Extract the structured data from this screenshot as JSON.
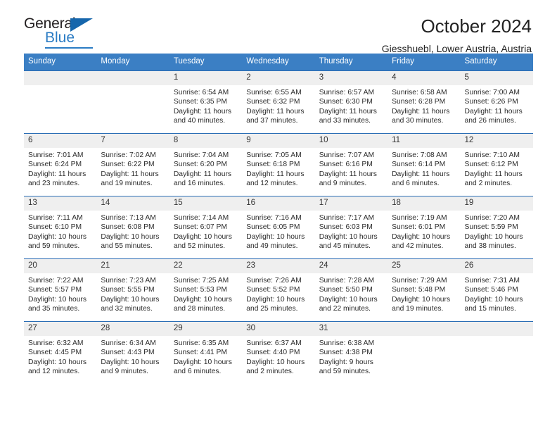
{
  "brand": {
    "name_top": "General",
    "name_bottom": "Blue",
    "accent_color": "#2b7cc4",
    "triangle_color": "#1666ac"
  },
  "header": {
    "title": "October 2024",
    "subtitle": "Giesshuebl, Lower Austria, Austria"
  },
  "theme": {
    "header_row_bg": "#3b7fc4",
    "row_divider": "#2a6db5",
    "daynum_bg": "#efefef",
    "text": "#222222"
  },
  "weekday_headers": [
    "Sunday",
    "Monday",
    "Tuesday",
    "Wednesday",
    "Thursday",
    "Friday",
    "Saturday"
  ],
  "weeks": [
    [
      {
        "day": "",
        "sunrise": "",
        "sunset": "",
        "daylight": ""
      },
      {
        "day": "",
        "sunrise": "",
        "sunset": "",
        "daylight": ""
      },
      {
        "day": "1",
        "sunrise": "Sunrise: 6:54 AM",
        "sunset": "Sunset: 6:35 PM",
        "daylight": "Daylight: 11 hours and 40 minutes."
      },
      {
        "day": "2",
        "sunrise": "Sunrise: 6:55 AM",
        "sunset": "Sunset: 6:32 PM",
        "daylight": "Daylight: 11 hours and 37 minutes."
      },
      {
        "day": "3",
        "sunrise": "Sunrise: 6:57 AM",
        "sunset": "Sunset: 6:30 PM",
        "daylight": "Daylight: 11 hours and 33 minutes."
      },
      {
        "day": "4",
        "sunrise": "Sunrise: 6:58 AM",
        "sunset": "Sunset: 6:28 PM",
        "daylight": "Daylight: 11 hours and 30 minutes."
      },
      {
        "day": "5",
        "sunrise": "Sunrise: 7:00 AM",
        "sunset": "Sunset: 6:26 PM",
        "daylight": "Daylight: 11 hours and 26 minutes."
      }
    ],
    [
      {
        "day": "6",
        "sunrise": "Sunrise: 7:01 AM",
        "sunset": "Sunset: 6:24 PM",
        "daylight": "Daylight: 11 hours and 23 minutes."
      },
      {
        "day": "7",
        "sunrise": "Sunrise: 7:02 AM",
        "sunset": "Sunset: 6:22 PM",
        "daylight": "Daylight: 11 hours and 19 minutes."
      },
      {
        "day": "8",
        "sunrise": "Sunrise: 7:04 AM",
        "sunset": "Sunset: 6:20 PM",
        "daylight": "Daylight: 11 hours and 16 minutes."
      },
      {
        "day": "9",
        "sunrise": "Sunrise: 7:05 AM",
        "sunset": "Sunset: 6:18 PM",
        "daylight": "Daylight: 11 hours and 12 minutes."
      },
      {
        "day": "10",
        "sunrise": "Sunrise: 7:07 AM",
        "sunset": "Sunset: 6:16 PM",
        "daylight": "Daylight: 11 hours and 9 minutes."
      },
      {
        "day": "11",
        "sunrise": "Sunrise: 7:08 AM",
        "sunset": "Sunset: 6:14 PM",
        "daylight": "Daylight: 11 hours and 6 minutes."
      },
      {
        "day": "12",
        "sunrise": "Sunrise: 7:10 AM",
        "sunset": "Sunset: 6:12 PM",
        "daylight": "Daylight: 11 hours and 2 minutes."
      }
    ],
    [
      {
        "day": "13",
        "sunrise": "Sunrise: 7:11 AM",
        "sunset": "Sunset: 6:10 PM",
        "daylight": "Daylight: 10 hours and 59 minutes."
      },
      {
        "day": "14",
        "sunrise": "Sunrise: 7:13 AM",
        "sunset": "Sunset: 6:08 PM",
        "daylight": "Daylight: 10 hours and 55 minutes."
      },
      {
        "day": "15",
        "sunrise": "Sunrise: 7:14 AM",
        "sunset": "Sunset: 6:07 PM",
        "daylight": "Daylight: 10 hours and 52 minutes."
      },
      {
        "day": "16",
        "sunrise": "Sunrise: 7:16 AM",
        "sunset": "Sunset: 6:05 PM",
        "daylight": "Daylight: 10 hours and 49 minutes."
      },
      {
        "day": "17",
        "sunrise": "Sunrise: 7:17 AM",
        "sunset": "Sunset: 6:03 PM",
        "daylight": "Daylight: 10 hours and 45 minutes."
      },
      {
        "day": "18",
        "sunrise": "Sunrise: 7:19 AM",
        "sunset": "Sunset: 6:01 PM",
        "daylight": "Daylight: 10 hours and 42 minutes."
      },
      {
        "day": "19",
        "sunrise": "Sunrise: 7:20 AM",
        "sunset": "Sunset: 5:59 PM",
        "daylight": "Daylight: 10 hours and 38 minutes."
      }
    ],
    [
      {
        "day": "20",
        "sunrise": "Sunrise: 7:22 AM",
        "sunset": "Sunset: 5:57 PM",
        "daylight": "Daylight: 10 hours and 35 minutes."
      },
      {
        "day": "21",
        "sunrise": "Sunrise: 7:23 AM",
        "sunset": "Sunset: 5:55 PM",
        "daylight": "Daylight: 10 hours and 32 minutes."
      },
      {
        "day": "22",
        "sunrise": "Sunrise: 7:25 AM",
        "sunset": "Sunset: 5:53 PM",
        "daylight": "Daylight: 10 hours and 28 minutes."
      },
      {
        "day": "23",
        "sunrise": "Sunrise: 7:26 AM",
        "sunset": "Sunset: 5:52 PM",
        "daylight": "Daylight: 10 hours and 25 minutes."
      },
      {
        "day": "24",
        "sunrise": "Sunrise: 7:28 AM",
        "sunset": "Sunset: 5:50 PM",
        "daylight": "Daylight: 10 hours and 22 minutes."
      },
      {
        "day": "25",
        "sunrise": "Sunrise: 7:29 AM",
        "sunset": "Sunset: 5:48 PM",
        "daylight": "Daylight: 10 hours and 19 minutes."
      },
      {
        "day": "26",
        "sunrise": "Sunrise: 7:31 AM",
        "sunset": "Sunset: 5:46 PM",
        "daylight": "Daylight: 10 hours and 15 minutes."
      }
    ],
    [
      {
        "day": "27",
        "sunrise": "Sunrise: 6:32 AM",
        "sunset": "Sunset: 4:45 PM",
        "daylight": "Daylight: 10 hours and 12 minutes."
      },
      {
        "day": "28",
        "sunrise": "Sunrise: 6:34 AM",
        "sunset": "Sunset: 4:43 PM",
        "daylight": "Daylight: 10 hours and 9 minutes."
      },
      {
        "day": "29",
        "sunrise": "Sunrise: 6:35 AM",
        "sunset": "Sunset: 4:41 PM",
        "daylight": "Daylight: 10 hours and 6 minutes."
      },
      {
        "day": "30",
        "sunrise": "Sunrise: 6:37 AM",
        "sunset": "Sunset: 4:40 PM",
        "daylight": "Daylight: 10 hours and 2 minutes."
      },
      {
        "day": "31",
        "sunrise": "Sunrise: 6:38 AM",
        "sunset": "Sunset: 4:38 PM",
        "daylight": "Daylight: 9 hours and 59 minutes."
      },
      {
        "day": "",
        "sunrise": "",
        "sunset": "",
        "daylight": ""
      },
      {
        "day": "",
        "sunrise": "",
        "sunset": "",
        "daylight": ""
      }
    ]
  ]
}
